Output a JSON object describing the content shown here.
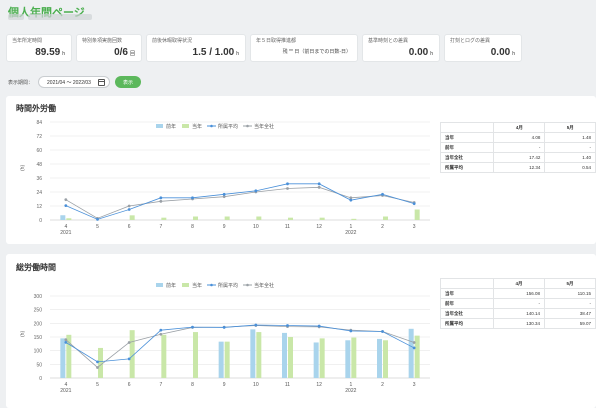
{
  "header": {
    "title": "個人年間ページ"
  },
  "kpis": [
    {
      "label": "当年所定時間",
      "value": "89.59",
      "unit": "h",
      "width": 66
    },
    {
      "label": "特別条項実施回数",
      "value": "0/6",
      "unit": "回",
      "width": 66
    },
    {
      "label": "前後休暇取得状況",
      "value": "1.5 / 1.00",
      "unit": "h",
      "width": 100
    },
    {
      "label": "年５日取得推進都",
      "text": "残 ** 日（前日までの日数-日）",
      "width": 108
    },
    {
      "label": "基準時刻との差異",
      "value": "0.00",
      "unit": "h",
      "width": 78
    },
    {
      "label": "打刻とログの差異",
      "value": "0.00",
      "unit": "h",
      "width": 78
    }
  ],
  "filter": {
    "label": "表示期間：",
    "range": "2021/04 ～ 2022/03",
    "button": "表示"
  },
  "legend": [
    "前年",
    "当年",
    "所属平均",
    "当年全社"
  ],
  "colors": {
    "prev": "#a9d4ec",
    "curr": "#c9e7a8",
    "avg": "#4a90d9",
    "all": "#9aa0a6"
  },
  "months": [
    "4",
    "5",
    "6",
    "7",
    "8",
    "9",
    "10",
    "11",
    "12",
    "1",
    "2",
    "3"
  ],
  "years": {
    "first": "2021",
    "second": "2022"
  },
  "overtime": {
    "title": "時間外労働",
    "yticks": [
      "0",
      "12",
      "24",
      "36",
      "48",
      "60",
      "72",
      "84"
    ],
    "yaxis_label": "(h)",
    "chart_data": {
      "type": "bar",
      "ylim": [
        0,
        84
      ],
      "series": [
        {
          "name": "前年",
          "values": [
            4.08,
            0,
            0,
            0,
            0,
            0,
            0,
            0,
            0,
            0,
            0,
            0
          ]
        },
        {
          "name": "当年",
          "values": [
            1.48,
            0,
            4,
            2,
            3,
            3,
            3,
            2,
            2,
            1,
            3,
            9
          ]
        },
        {
          "name": "所属平均",
          "values": [
            12.34,
            0.54,
            9,
            19,
            19,
            22,
            25,
            31,
            31,
            17,
            22,
            14
          ]
        },
        {
          "name": "当年全社",
          "values": [
            17.42,
            1.4,
            12,
            16,
            18,
            20,
            24,
            27,
            28,
            19,
            21,
            15
          ]
        }
      ]
    },
    "table": {
      "headers": [
        "",
        "4月",
        "5月"
      ],
      "rows": [
        [
          "当年",
          "4.08",
          "1.48"
        ],
        [
          "前年",
          "-",
          "-"
        ],
        [
          "当年全社",
          "17.42",
          "1.40"
        ],
        [
          "所属平均",
          "12.34",
          "0.54"
        ]
      ]
    }
  },
  "worktime": {
    "title": "総労働時間",
    "yticks": [
      "0",
      "50",
      "100",
      "150",
      "200",
      "250",
      "300"
    ],
    "yaxis_label": "(h)",
    "chart_data": {
      "type": "bar",
      "ylim": [
        0,
        300
      ],
      "series": [
        {
          "name": "前年",
          "values": [
            145,
            0,
            0,
            0,
            0,
            133,
            178,
            165,
            130,
            138,
            143,
            180
          ]
        },
        {
          "name": "当年",
          "values": [
            158,
            110,
            175,
            158,
            168,
            133,
            168,
            150,
            145,
            148,
            138,
            155
          ]
        },
        {
          "name": "所属平均",
          "values": [
            130.34,
            59.07,
            70,
            175,
            186,
            185,
            194,
            192,
            190,
            172,
            170,
            110
          ]
        },
        {
          "name": "当年全社",
          "values": [
            140.14,
            38.47,
            130,
            160,
            185,
            186,
            192,
            188,
            187,
            175,
            170,
            130
          ]
        }
      ]
    },
    "table": {
      "headers": [
        "",
        "4月",
        "5月"
      ],
      "rows": [
        [
          "当年",
          "156.08",
          "110.15"
        ],
        [
          "前年",
          "-",
          "-"
        ],
        [
          "当年全社",
          "140.14",
          "38.47"
        ],
        [
          "所属平均",
          "130.34",
          "59.07"
        ]
      ]
    }
  }
}
